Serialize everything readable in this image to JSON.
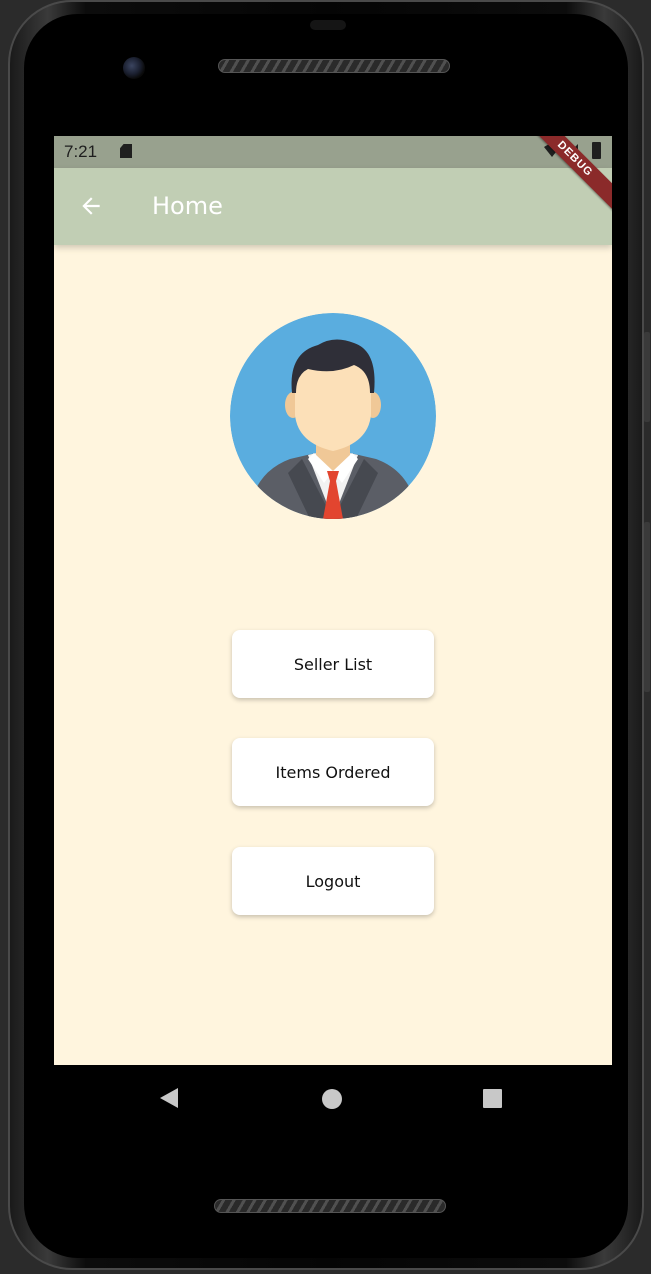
{
  "status_bar": {
    "time": "7:21",
    "debug_banner": "DEBUG"
  },
  "app_bar": {
    "title": "Home",
    "back_icon": "arrow-back-icon"
  },
  "avatar": {
    "icon": "businessman-avatar-icon",
    "colors": {
      "background": "#5aaddf",
      "skin": "#fce0b8",
      "hair": "#2f2f38",
      "suit": "#5b5e66",
      "tie": "#e2452f"
    }
  },
  "menu": {
    "seller_list_label": "Seller List",
    "items_ordered_label": "Items Ordered",
    "logout_label": "Logout"
  },
  "nav_bar": {
    "back_icon": "nav-back-triangle-icon",
    "home_icon": "nav-home-circle-icon",
    "recent_icon": "nav-recent-square-icon"
  },
  "colors": {
    "app_bar": "#c1ceb4",
    "status_bar": "#98a18e",
    "page_background": "#fff5de",
    "button_background": "#ffffff"
  }
}
